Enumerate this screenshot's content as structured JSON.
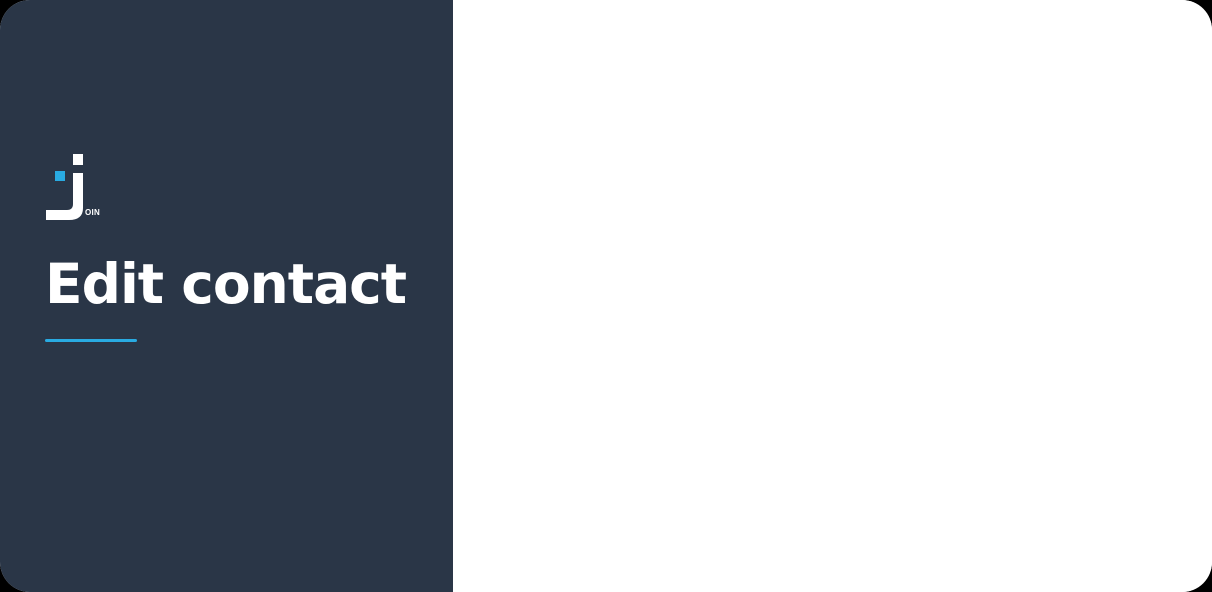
{
  "logo": {
    "name": "join-logo-icon",
    "suffix_text": "OIN",
    "accent_color": "#29abe2",
    "mark_color": "#ffffff"
  },
  "header": {
    "title": "Edit contact",
    "underline_color": "#29abe2"
  },
  "colors": {
    "panel_background": "#2a3647",
    "content_background": "#ffffff"
  }
}
